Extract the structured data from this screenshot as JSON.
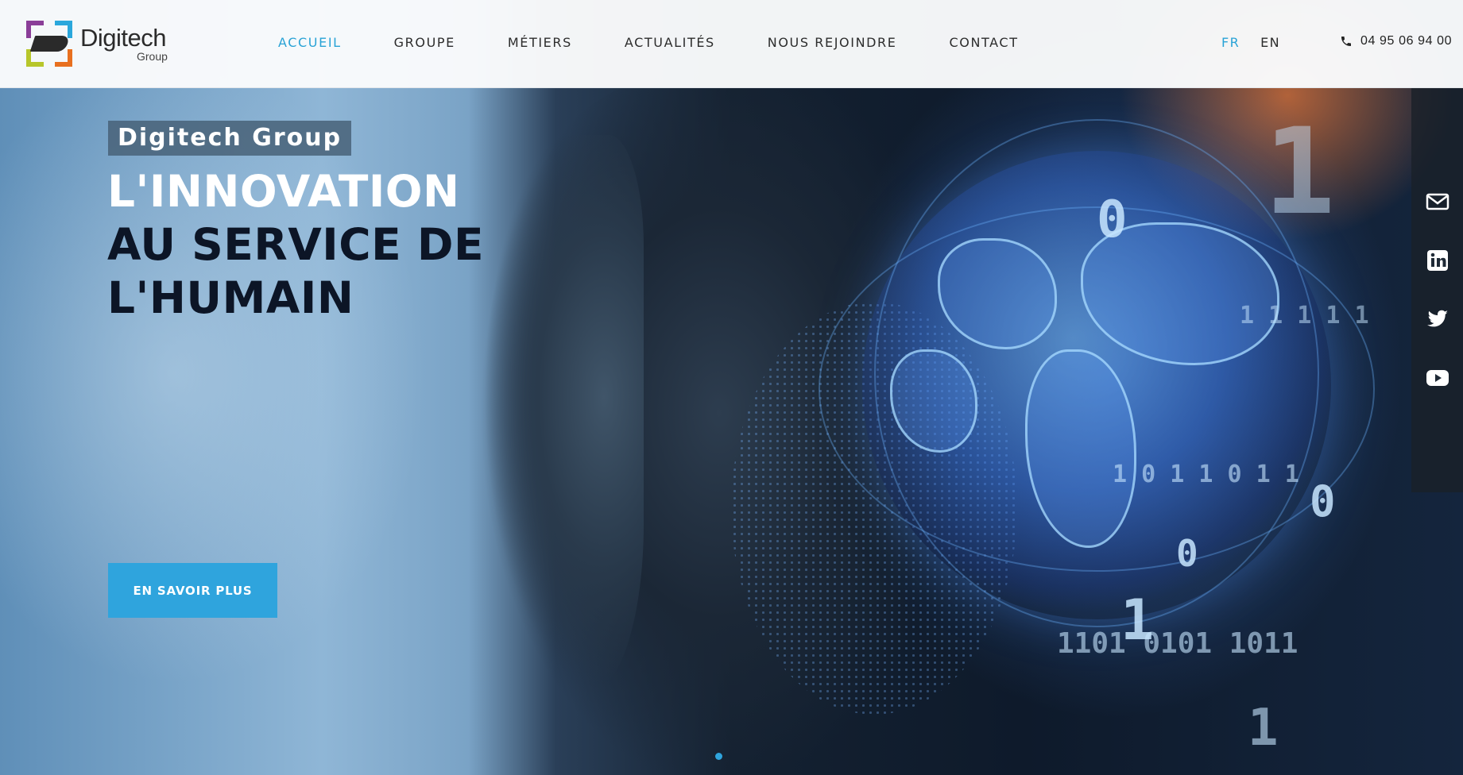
{
  "header": {
    "logo": {
      "name": "Digitech",
      "sub": "Group"
    },
    "nav": [
      "ACCUEIL",
      "GROUPE",
      "MÉTIERS",
      "ACTUALITÉS",
      "NOUS REJOINDRE",
      "CONTACT"
    ],
    "active_nav": "ACCUEIL",
    "languages": [
      "FR",
      "EN"
    ],
    "active_language": "FR",
    "phone": "04 95 06 94 00"
  },
  "hero": {
    "tag": "Digitech Group",
    "headline_line1": "L'INNOVATION",
    "headline_line2": "AU SERVICE DE",
    "headline_line3": "L'HUMAIN",
    "cta": "EN SAVOIR PLUS"
  },
  "social": [
    "mail-icon",
    "linkedin-icon",
    "twitter-icon",
    "youtube-icon"
  ],
  "colors": {
    "accent": "#2fa4dd",
    "dark": "#0c1526"
  }
}
